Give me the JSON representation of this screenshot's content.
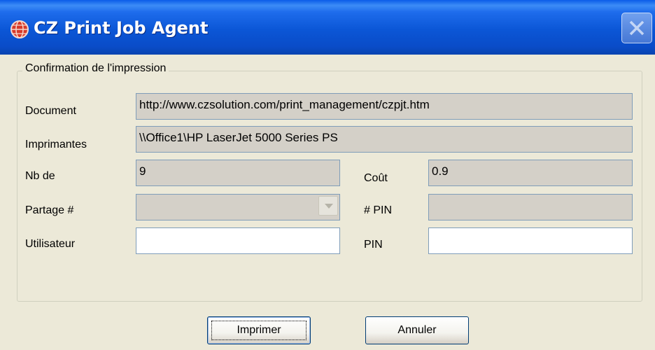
{
  "window": {
    "title": "CZ Print Job Agent",
    "icon": "globe-icon",
    "close_icon": "close-icon"
  },
  "group": {
    "legend": "Confirmation de l'impression"
  },
  "form": {
    "document_label": "Document",
    "document_value": "http://www.czsolution.com/print_management/czpjt.htm",
    "printer_label": "Imprimantes",
    "printer_value": "\\\\Office1\\HP LaserJet 5000 Series PS",
    "copies_label": "Nb de",
    "copies_value": "9",
    "cost_label": "Coût",
    "cost_value": "0.9",
    "share_label": "Partage  #",
    "share_value": "",
    "pin_number_label": "# PIN",
    "pin_number_value": "",
    "user_label": "Utilisateur",
    "user_value": "",
    "pin_label": "PIN",
    "pin_value": ""
  },
  "buttons": {
    "print_label": "Imprimer",
    "cancel_label": "Annuler"
  },
  "colors": {
    "titlebar": "#0a5ce8",
    "dialog_bg": "#ece9d8",
    "readonly_field": "#d4d0c8"
  }
}
